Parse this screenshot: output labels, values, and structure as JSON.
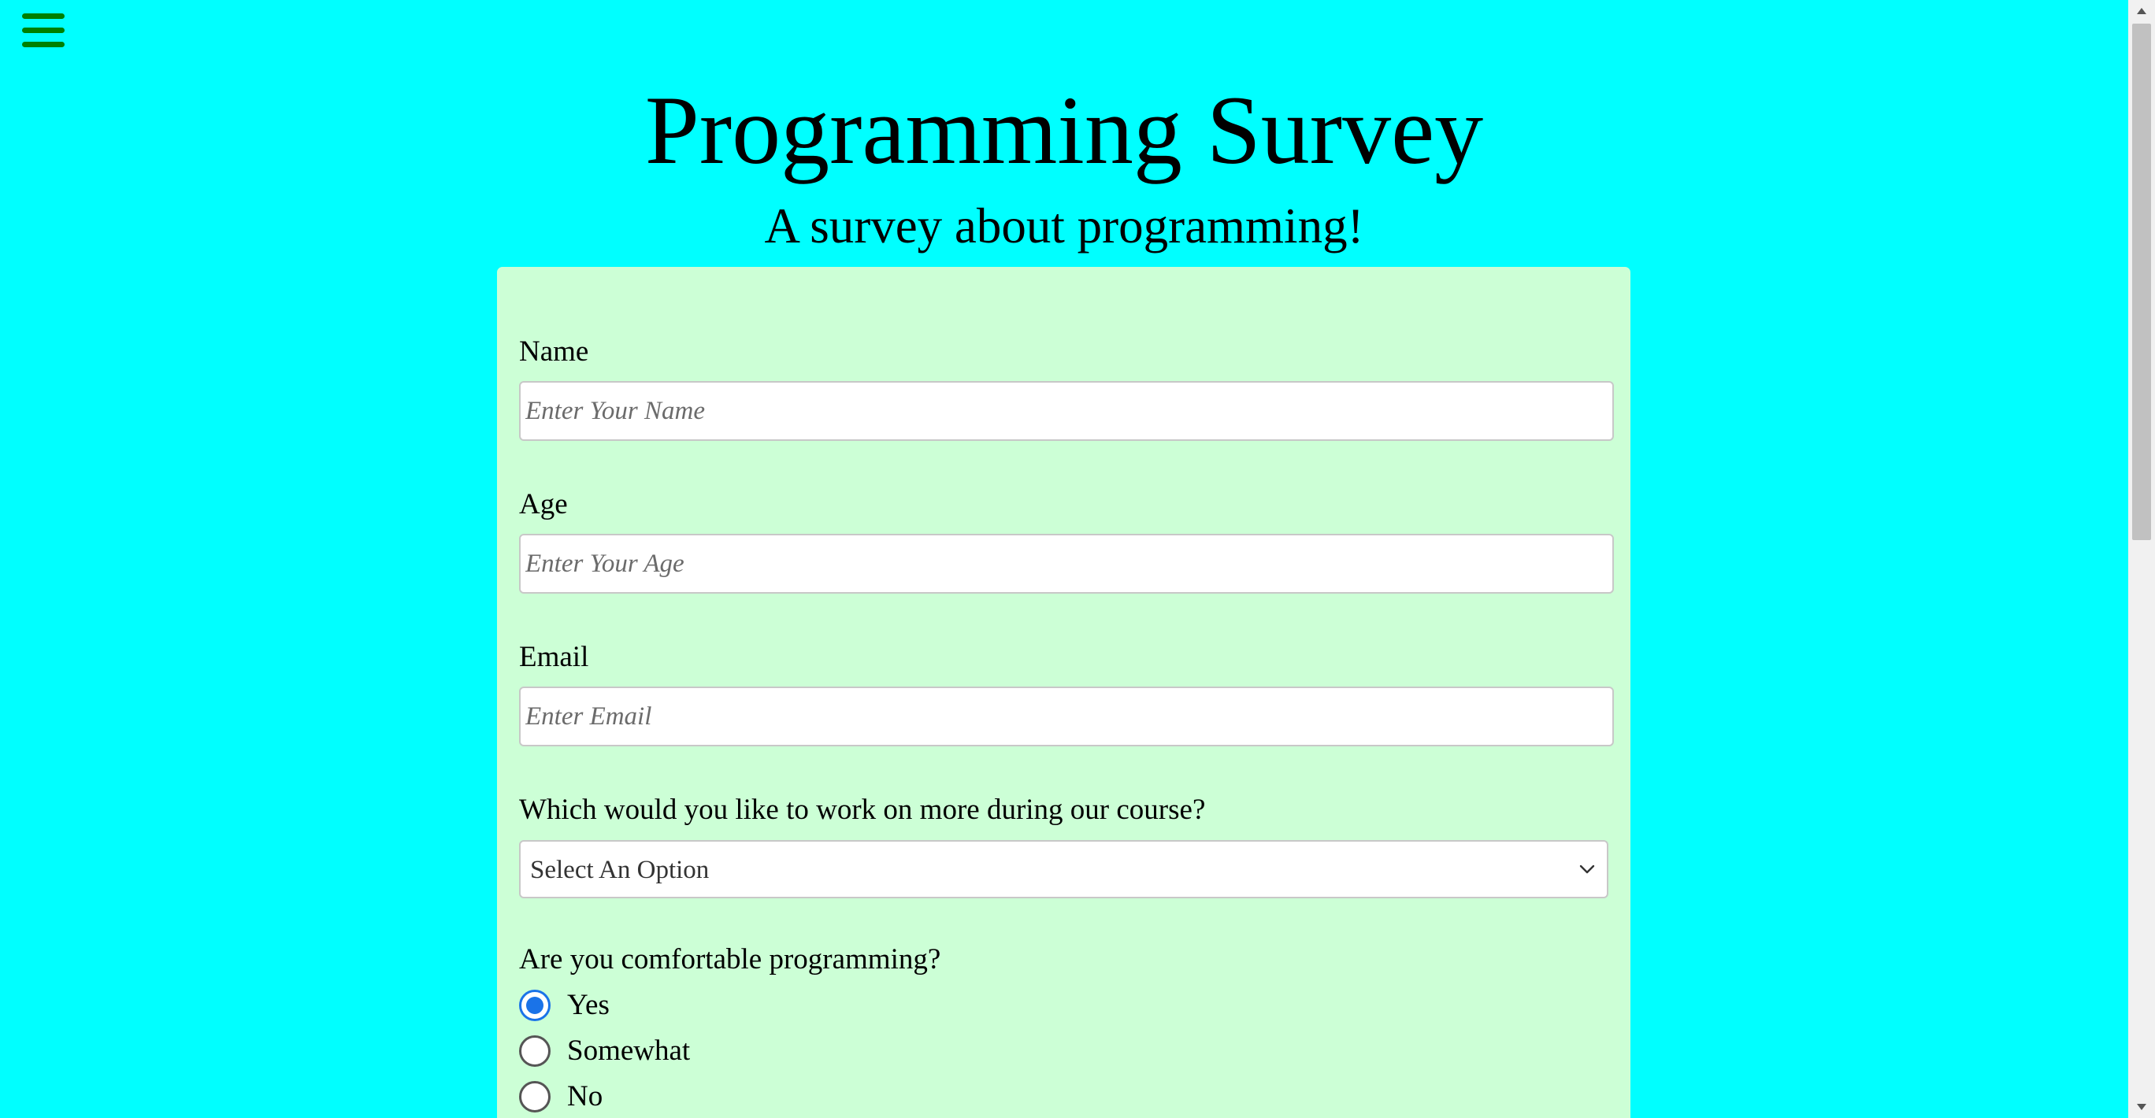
{
  "menu": {
    "icon": "hamburger-menu-icon",
    "color": "#008000"
  },
  "header": {
    "title": "Programming Survey",
    "description": "A survey about programming!"
  },
  "colors": {
    "page_background": "#00ffff",
    "form_background": "#ccffd6",
    "radio_accent": "#1a73e8"
  },
  "form": {
    "name": {
      "label": "Name",
      "value": "",
      "placeholder": "Enter Your Name"
    },
    "age": {
      "label": "Age",
      "value": "",
      "placeholder": "Enter Your Age"
    },
    "email": {
      "label": "Email",
      "value": "",
      "placeholder": "Enter Email"
    },
    "course_focus": {
      "label": "Which would you like to work on more during our course?",
      "selected": "Select An Option"
    },
    "comfort": {
      "label": "Are you comfortable programming?",
      "options": [
        {
          "label": "Yes",
          "checked": true
        },
        {
          "label": "Somewhat",
          "checked": false
        },
        {
          "label": "No",
          "checked": false
        }
      ]
    }
  }
}
